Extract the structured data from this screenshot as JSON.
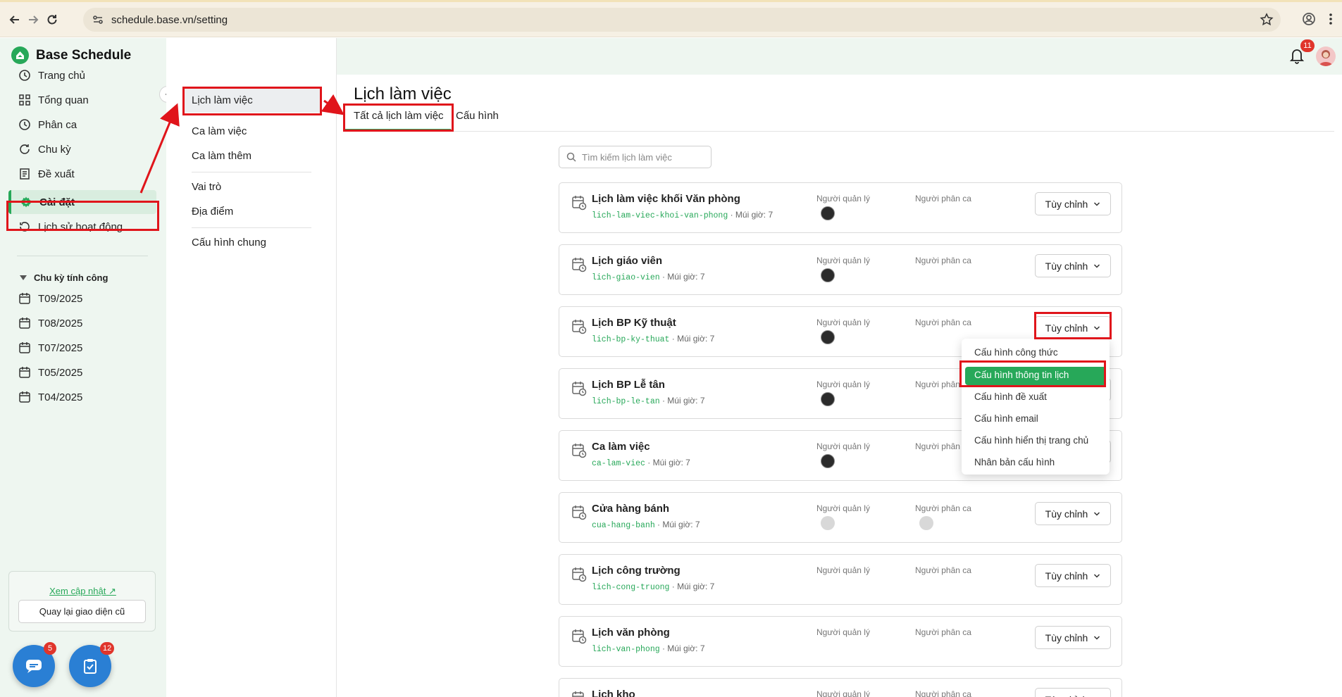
{
  "browser": {
    "url": "schedule.base.vn/setting"
  },
  "app": {
    "name": "Base Schedule",
    "notification_count": "11"
  },
  "sidebar": {
    "items": [
      {
        "label": "Trang chủ",
        "icon": "clock-icon"
      },
      {
        "label": "Tổng quan",
        "icon": "grid-icon"
      },
      {
        "label": "Phân ca",
        "icon": "clock-icon"
      },
      {
        "label": "Chu kỳ",
        "icon": "cycle-icon"
      },
      {
        "label": "Đề xuất",
        "icon": "proposal-icon"
      },
      {
        "label": "Cài đặt",
        "icon": "gear-icon",
        "active": true
      },
      {
        "label": "Lịch sử hoạt động",
        "icon": "history-icon"
      }
    ],
    "cycle_heading": "Chu kỳ tính công",
    "cycles": [
      "T09/2025",
      "T08/2025",
      "T07/2025",
      "T05/2025",
      "T04/2025"
    ],
    "update_link": "Xem cập nhật",
    "old_ui_button": "Quay lại giao diện cũ",
    "chat_badge": "5",
    "task_badge": "12"
  },
  "subnav": {
    "items": [
      "Lịch làm việc",
      "Ca làm việc",
      "Ca làm thêm",
      "Vai trò",
      "Địa điểm",
      "Cấu hình chung"
    ]
  },
  "main": {
    "title": "Lịch làm việc",
    "tabs": [
      "Tất cả lịch làm việc",
      "Cấu hình"
    ],
    "search_placeholder": "Tìm kiếm lịch làm việc",
    "manager_label": "Người quản lý",
    "scheduler_label": "Người phân ca",
    "custom_button": "Tùy chỉnh",
    "timezone_text": " · Múi giờ: 7",
    "schedules": [
      {
        "name": "Lịch làm việc khối Văn phòng",
        "code": "lich-lam-viec-khoi-van-phong",
        "manager": "dark",
        "scheduler": ""
      },
      {
        "name": "Lịch giáo viên",
        "code": "lich-giao-vien",
        "manager": "dark",
        "scheduler": ""
      },
      {
        "name": "Lịch BP Kỹ thuật",
        "code": "lich-bp-ky-thuat",
        "manager": "dark",
        "scheduler": ""
      },
      {
        "name": "Lịch BP Lễ tân",
        "code": "lich-bp-le-tan",
        "manager": "dark",
        "scheduler": ""
      },
      {
        "name": "Ca làm việc",
        "code": "ca-lam-viec",
        "manager": "dark",
        "scheduler": ""
      },
      {
        "name": "Cửa hàng bánh",
        "code": "cua-hang-banh",
        "manager": "grey",
        "scheduler": "grey"
      },
      {
        "name": "Lịch công trường",
        "code": "lich-cong-truong",
        "manager": "",
        "scheduler": ""
      },
      {
        "name": "Lịch văn phòng",
        "code": "lich-van-phong",
        "manager": "",
        "scheduler": ""
      },
      {
        "name": "Lịch kho",
        "code": "",
        "manager": "",
        "scheduler": ""
      }
    ]
  },
  "dropdown": {
    "items": [
      "Cấu hình công thức",
      "Cấu hình thông tin lịch",
      "Cấu hình đề xuất",
      "Cấu hình email",
      "Cấu hình hiển thị trang chủ",
      "Nhân bản cấu hình"
    ],
    "active_index": 1
  },
  "colors": {
    "accent": "#27a859",
    "annotation": "#e0151b",
    "sidebar_bg": "#eef6f0"
  }
}
